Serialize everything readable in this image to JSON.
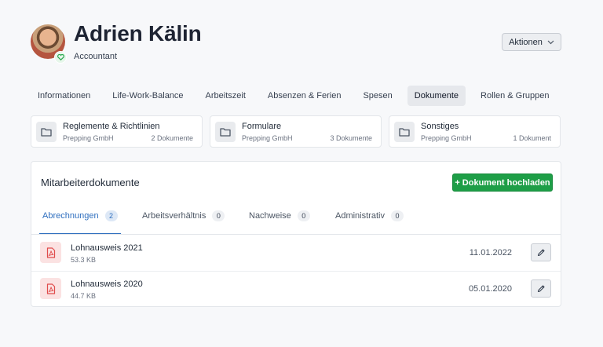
{
  "profile": {
    "name": "Adrien Kälin",
    "role": "Accountant",
    "actions_label": "Aktionen"
  },
  "tabs": [
    {
      "label": "Informationen",
      "active": false
    },
    {
      "label": "Life-Work-Balance",
      "active": false
    },
    {
      "label": "Arbeitszeit",
      "active": false
    },
    {
      "label": "Absenzen & Ferien",
      "active": false
    },
    {
      "label": "Spesen",
      "active": false
    },
    {
      "label": "Dokumente",
      "active": true
    },
    {
      "label": "Rollen & Gruppen",
      "active": false
    }
  ],
  "folders": [
    {
      "title": "Reglemente & Richtlinien",
      "company": "Prepping GmbH",
      "count": "2 Dokumente"
    },
    {
      "title": "Formulare",
      "company": "Prepping GmbH",
      "count": "3 Dokumente"
    },
    {
      "title": "Sonstiges",
      "company": "Prepping GmbH",
      "count": "1 Dokument"
    }
  ],
  "documents_panel": {
    "title": "Mitarbeiterdokumente",
    "upload_label": "+ Dokument hochladen",
    "tabs": [
      {
        "label": "Abrechnungen",
        "count": "2",
        "active": true
      },
      {
        "label": "Arbeitsverhältnis",
        "count": "0",
        "active": false
      },
      {
        "label": "Nachweise",
        "count": "0",
        "active": false
      },
      {
        "label": "Administrativ",
        "count": "0",
        "active": false
      }
    ],
    "rows": [
      {
        "name": "Lohnausweis 2021",
        "size": "53.3 KB",
        "date": "11.01.2022"
      },
      {
        "name": "Lohnausweis 2020",
        "size": "44.7 KB",
        "date": "05.01.2020"
      }
    ]
  },
  "colors": {
    "accent_blue": "#2f6fbf",
    "upload_green": "#1e9e47",
    "pdf_red": "#e04b4b",
    "badge_green": "#2aa94f"
  },
  "icons": {
    "actions": "chevron-down-icon",
    "folder": "folder-icon",
    "file": "pdf-file-icon",
    "edit": "pencil-icon",
    "avatar_badge": "heart-icon"
  }
}
